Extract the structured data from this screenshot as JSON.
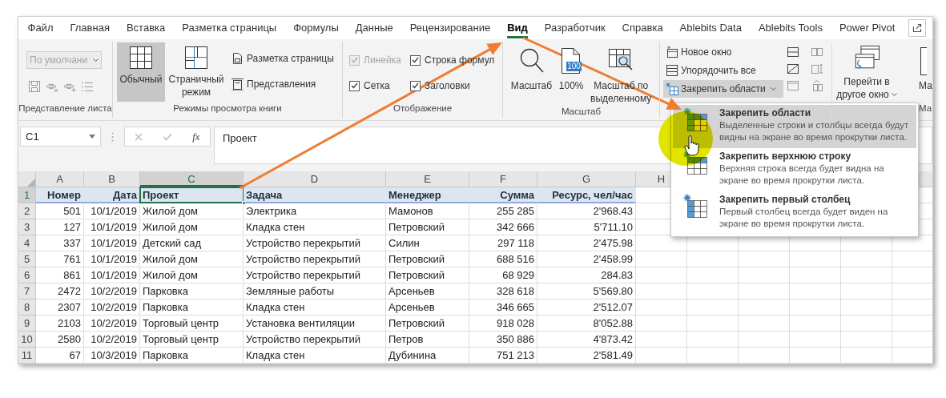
{
  "tabs": [
    {
      "label": "Файл",
      "selected": false
    },
    {
      "label": "Главная",
      "selected": false
    },
    {
      "label": "Вставка",
      "selected": false
    },
    {
      "label": "Разметка страницы",
      "selected": false
    },
    {
      "label": "Формулы",
      "selected": false
    },
    {
      "label": "Данные",
      "selected": false
    },
    {
      "label": "Рецензирование",
      "selected": false
    },
    {
      "label": "Вид",
      "selected": true
    },
    {
      "label": "Разработчик",
      "selected": false
    },
    {
      "label": "Справка",
      "selected": false
    },
    {
      "label": "Ablebits Data",
      "selected": false
    },
    {
      "label": "Ablebits Tools",
      "selected": false
    },
    {
      "label": "Power Pivot",
      "selected": false
    }
  ],
  "ribbon": {
    "groups": [
      {
        "kind": "sheet_view",
        "label": "Представление листа",
        "view_dropdown": {
          "value": "По умолчани",
          "disabled": true
        }
      },
      {
        "kind": "views",
        "label": "Режимы просмотра книги",
        "large_buttons": [
          {
            "label": "Обычный",
            "selected": true
          },
          {
            "label": "Страничный режим",
            "selected": false
          }
        ],
        "small_buttons": [
          "Разметка страницы",
          "Представления"
        ]
      },
      {
        "kind": "show",
        "label": "Отображение",
        "checkboxes": [
          {
            "label": "Линейка",
            "checked": true,
            "disabled": true
          },
          {
            "label": "Строка формул",
            "checked": true,
            "disabled": false
          },
          {
            "label": "Сетка",
            "checked": true,
            "disabled": false
          },
          {
            "label": "Заголовки",
            "checked": true,
            "disabled": false
          }
        ]
      },
      {
        "kind": "zoom",
        "label": "Масштаб",
        "buttons": [
          {
            "kind": "zoom",
            "label": "Масштаб"
          },
          {
            "kind": "hundred",
            "label": "100%",
            "badge": "100"
          },
          {
            "kind": "selection",
            "label": "Масштаб по выделенному"
          }
        ]
      },
      {
        "kind": "window",
        "small_buttons": [
          {
            "kind": "new",
            "label": "Новое окно",
            "has_menu": false,
            "expanded": false
          },
          {
            "kind": "arrange",
            "label": "Упорядочить все",
            "has_menu": false,
            "expanded": false
          },
          {
            "kind": "freeze",
            "label": "Закрепить области",
            "has_menu": true,
            "expanded": true
          }
        ],
        "switch_button": {
          "label": "Перейти в другое окно"
        }
      },
      {
        "kind": "cut",
        "button_label": "Ма",
        "label": "Ма"
      }
    ]
  },
  "formula_bar": {
    "name_box": "C1",
    "function_button": "fx",
    "formula": "Проект"
  },
  "sheet": {
    "columns": [
      {
        "label": "A",
        "selected": false
      },
      {
        "label": "B",
        "selected": false
      },
      {
        "label": "C",
        "selected": true
      },
      {
        "label": "D",
        "selected": false
      },
      {
        "label": "E",
        "selected": false
      },
      {
        "label": "F",
        "selected": false
      },
      {
        "label": "G",
        "selected": false
      },
      {
        "label": "H",
        "selected": false
      }
    ],
    "rows": [
      {
        "number": "1",
        "kind": "header",
        "selected": true,
        "cells": [
          "Номер",
          "Дата",
          "Проект",
          "Задача",
          "Менеджер",
          "Сумма",
          "Ресурс, чел/час"
        ]
      },
      {
        "number": "2",
        "kind": "data",
        "selected": false,
        "cells": [
          "501",
          "10/1/2019",
          "Жилой дом",
          "Электрика",
          "Мамонов",
          "255 285",
          "2'968.43"
        ]
      },
      {
        "number": "3",
        "kind": "data",
        "selected": false,
        "cells": [
          "127",
          "10/1/2019",
          "Жилой дом",
          "Кладка стен",
          "Петровский",
          "342 666",
          "5'711.10"
        ]
      },
      {
        "number": "4",
        "kind": "data",
        "selected": false,
        "cells": [
          "337",
          "10/1/2019",
          "Детский сад",
          "Устройство перекрытий",
          "Силин",
          "297 118",
          "2'475.98"
        ]
      },
      {
        "number": "5",
        "kind": "data",
        "selected": false,
        "cells": [
          "761",
          "10/1/2019",
          "Жилой дом",
          "Устройство перекрытий",
          "Петровский",
          "688 516",
          "2'458.99"
        ]
      },
      {
        "number": "6",
        "kind": "data",
        "selected": false,
        "cells": [
          "861",
          "10/1/2019",
          "Жилой дом",
          "Устройство перекрытий",
          "Петровский",
          "68 929",
          "284.83"
        ]
      },
      {
        "number": "7",
        "kind": "data",
        "selected": false,
        "cells": [
          "2472",
          "10/2/2019",
          "Парковка",
          "Земляные работы",
          "Арсеньев",
          "328 618",
          "5'569.80"
        ]
      },
      {
        "number": "8",
        "kind": "data",
        "selected": false,
        "cells": [
          "2307",
          "10/2/2019",
          "Парковка",
          "Кладка стен",
          "Арсеньев",
          "346 665",
          "2'512.07"
        ]
      },
      {
        "number": "9",
        "kind": "data",
        "selected": false,
        "cells": [
          "2103",
          "10/2/2019",
          "Торговый центр",
          "Установка вентиляции",
          "Петровский",
          "918 028",
          "8'052.88"
        ]
      },
      {
        "number": "10",
        "kind": "data",
        "selected": false,
        "cells": [
          "2580",
          "10/2/2019",
          "Торговый центр",
          "Устройство перекрытий",
          "Петров",
          "350 886",
          "4'873.42"
        ]
      },
      {
        "number": "11",
        "kind": "data",
        "selected": false,
        "cells": [
          "67",
          "10/3/2019",
          "Парковка",
          "Кладка стен",
          "Дубинина",
          "751 213",
          "2'581.49"
        ]
      }
    ]
  },
  "freeze_menu": {
    "items": [
      {
        "kind": "panes",
        "title": "Закрепить области",
        "description": "Выделенные строки и столбцы всегда будут видны на экране во время прокрутки листа.",
        "selected": true
      },
      {
        "kind": "top_row",
        "title": "Закрепить верхнюю строку",
        "description": "Верхняя строка всегда будет видна на экране во время прокрутки листа.",
        "selected": false
      },
      {
        "kind": "first_column",
        "title": "Закрепить первый столбец",
        "description": "Первый столбец всегда будет виден на экране во время прокрутки листа.",
        "selected": false
      }
    ]
  }
}
